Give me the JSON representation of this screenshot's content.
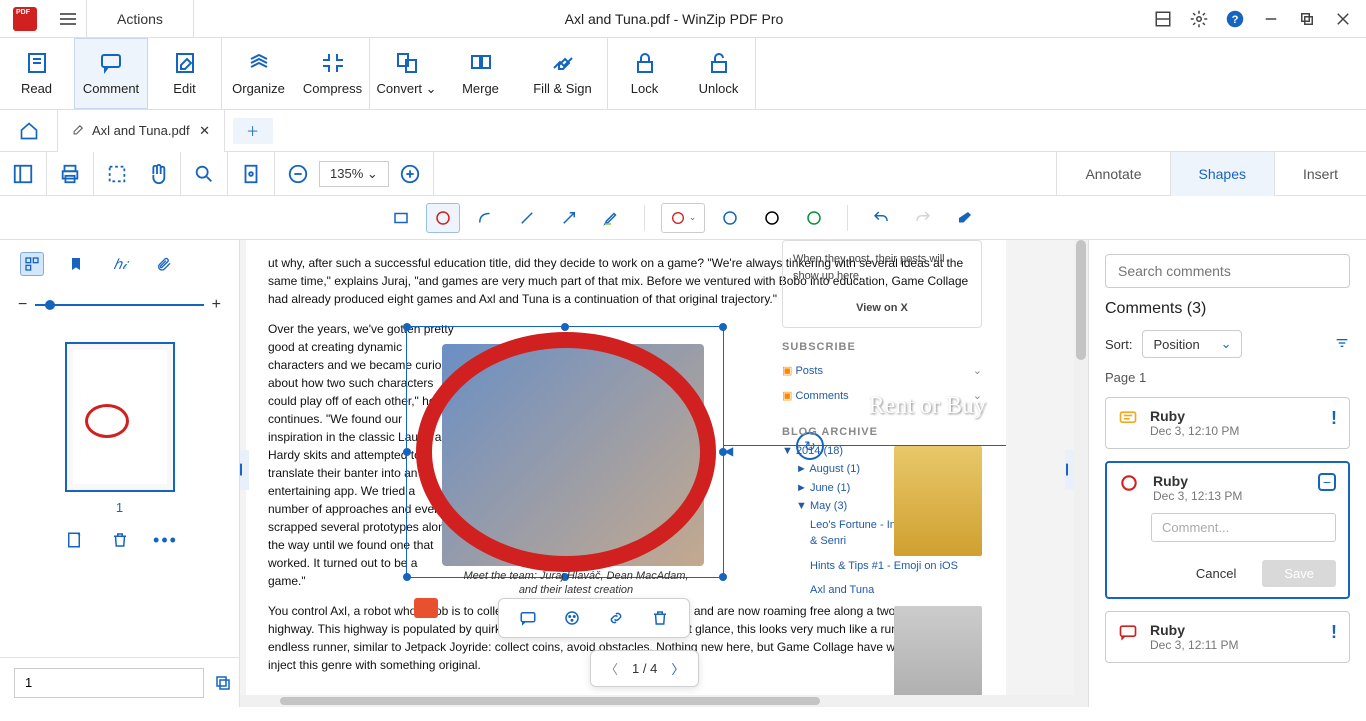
{
  "window": {
    "title": "Axl and Tuna.pdf - WinZip PDF Pro",
    "actions": "Actions"
  },
  "ribbon": [
    {
      "label": "Read"
    },
    {
      "label": "Comment"
    },
    {
      "label": "Edit"
    },
    {
      "label": "Organize"
    },
    {
      "label": "Compress"
    },
    {
      "label": "Convert ⌄"
    },
    {
      "label": "Merge"
    },
    {
      "label": "Fill & Sign"
    },
    {
      "label": "Lock"
    },
    {
      "label": "Unlock"
    }
  ],
  "tab": {
    "name": "Axl and Tuna.pdf"
  },
  "zoom": "135% ⌄",
  "righttabs": {
    "annotate": "Annotate",
    "shapes": "Shapes",
    "insert": "Insert"
  },
  "thumb": {
    "page_num": "1",
    "page_input": "1"
  },
  "pagenav": {
    "label": "1 / 4"
  },
  "doc": {
    "p1": "ut why, after such a successful education title, did they decide to work on a game? \"We're always tinkering with several ideas at the same time,\" explains Juraj, \"and games are very much part of that mix. Before we ventured with Bobo into education, Game Collage had already produced eight games and Axl and Tuna is a continuation of that original trajectory.\"",
    "p2": "Over the years, we've gotten pretty good at creating dynamic characters and we became curious about how two such characters could play off of each other,\" he continues. \"We found our inspiration in the classic Laurel and Hardy skits and attempted to translate their banter into an entertaining app. We tried a number of approaches and even scrapped several prototypes along the way until we found one that worked. It turned out to be a game.\"",
    "p3": "You control Axl, a robot whose job is to collect nuts and bolts that have escaped and are now roaming free along a two-dimensional highway. This highway is populated by quirky robots and other obstacles. At first glance, this looks very much like a run of the mill endless runner, similar to Jetpack Joyride: collect coins, avoid obstacles. Nothing new here, but Game Collage have worked hard to inject this genre with something original.",
    "cap1": "Meet the team: Juraj Hlaváč, Dean MacAdam,",
    "cap2": "and their latest creation",
    "sidecard": "When they post, their posts will show up here.",
    "viewon": "View on X",
    "subscribe": "SUBSCRIBE",
    "posts": "Posts",
    "comments_rss": "Comments",
    "blogarchive": "BLOG ARCHIVE",
    "arch_2014": "▼  2014 (18)",
    "arch_aug": "►  August (1)",
    "arch_jun": "►  June (1)",
    "arch_may": "▼  May (3)",
    "link1": "Leo's Fortune - Interview with 1337 & Senri",
    "link2": "Hints & Tips #1 - Emoji on iOS",
    "link3": "Axl and Tuna",
    "rentbuy": "Rent or Buy"
  },
  "comments": {
    "search_ph": "Search comments",
    "header": "Comments ",
    "count": "(3)",
    "sort_label": "Sort:",
    "sort_value": "Position",
    "page_label": "Page 1",
    "comment_ph": "Comment...",
    "cancel": "Cancel",
    "save": "Save",
    "items": [
      {
        "name": "Ruby",
        "time": "Dec 3, 12:10 PM"
      },
      {
        "name": "Ruby",
        "time": "Dec 3, 12:13 PM"
      },
      {
        "name": "Ruby",
        "time": "Dec 3, 12:11 PM"
      }
    ]
  }
}
